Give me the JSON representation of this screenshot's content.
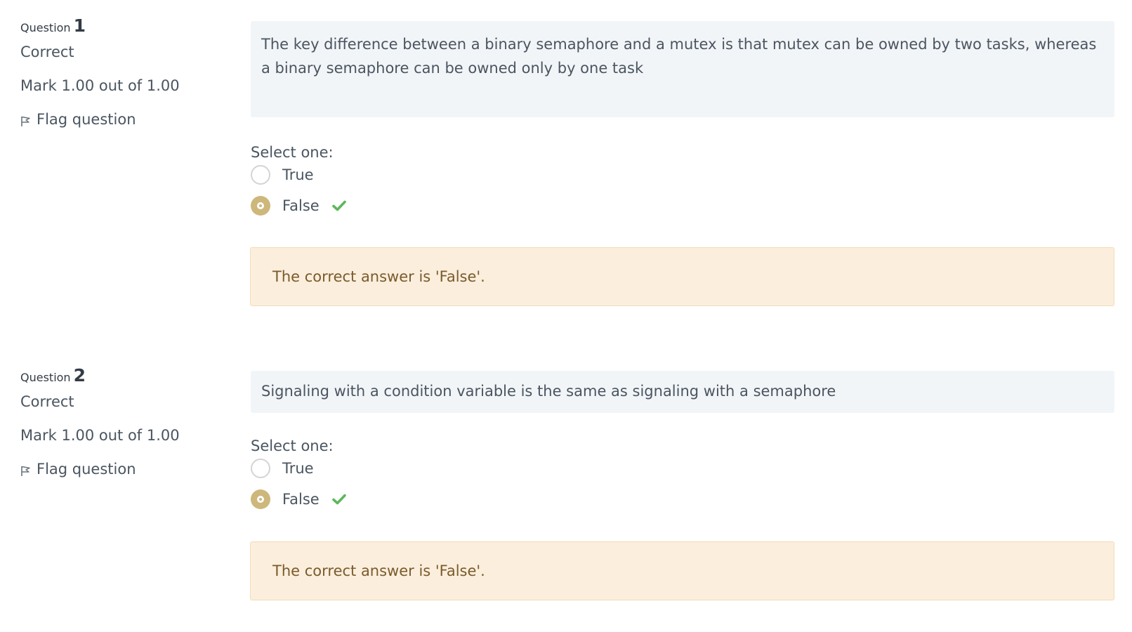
{
  "questions": [
    {
      "label": "Question",
      "number": "1",
      "state": "Correct",
      "grade": "Mark 1.00 out of 1.00",
      "flag_label": "Flag question",
      "text": "The key difference between a  binary semaphore and a mutex is that mutex can be owned by two tasks, whereas a binary semaphore can be owned only by one task",
      "prompt": "Select one:",
      "options": [
        {
          "label": "True",
          "selected": false
        },
        {
          "label": "False",
          "selected": true,
          "correct": true
        }
      ],
      "feedback": "The correct answer is 'False'."
    },
    {
      "label": "Question",
      "number": "2",
      "state": "Correct",
      "grade": "Mark 1.00 out of 1.00",
      "flag_label": "Flag question",
      "text": "Signaling with a condition variable is the same as signaling with a semaphore",
      "prompt": "Select one:",
      "options": [
        {
          "label": "True",
          "selected": false
        },
        {
          "label": "False",
          "selected": true,
          "correct": true
        }
      ],
      "feedback": "The correct answer is 'False'."
    }
  ],
  "colors": {
    "selected_radio": "#cdb77b",
    "check": "#5cb85c",
    "feedback_bg": "#fbeedd",
    "qtext_bg": "#f2f5f8"
  },
  "icons": [
    "flag-icon",
    "check-icon"
  ]
}
